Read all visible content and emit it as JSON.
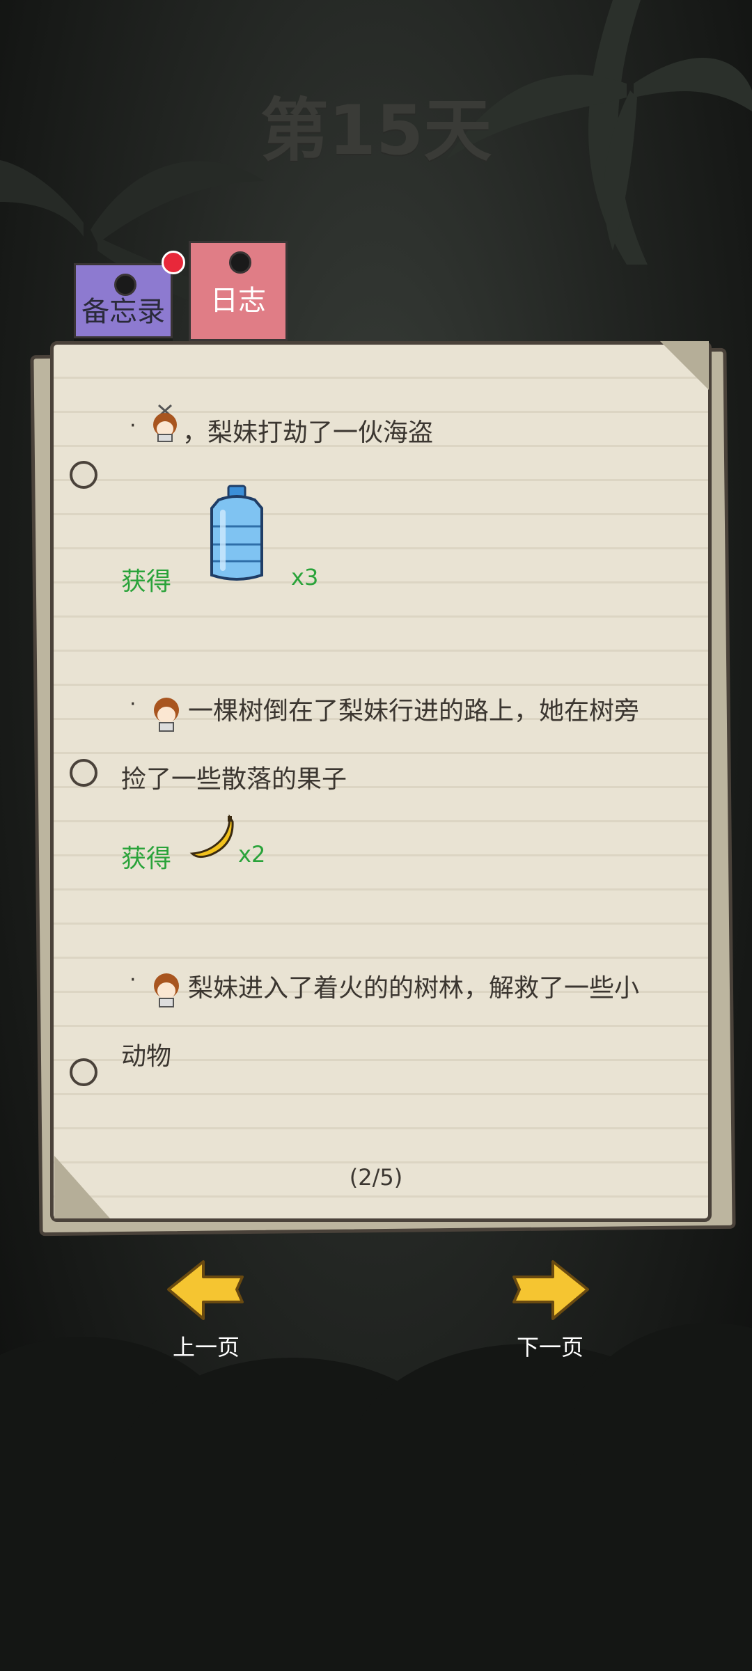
{
  "day_title": "第15天",
  "tabs": {
    "memo": "备忘录",
    "log": "日志"
  },
  "entries": [
    {
      "line1": "，梨妹打劫了一伙海盗",
      "reward_label": "获得",
      "reward_item": "water-jug-icon",
      "reward_qty": "x3"
    },
    {
      "line1": "一棵树倒在了梨妹行进的路上，她在树旁",
      "line2": "捡了一些散落的果子",
      "reward_label": "获得",
      "reward_item": "banana-icon",
      "reward_qty": "x2"
    },
    {
      "line1": "梨妹进入了着火的的树林，解救了一些小",
      "line2": "动物"
    }
  ],
  "bullet": "·",
  "page_indicator": "(2/5)",
  "nav": {
    "prev": "上一页",
    "next": "下一页"
  },
  "colors": {
    "memo_tab": "#8d7ad0",
    "log_tab": "#e07d86",
    "reward_green": "#2aa33a",
    "arrow_yellow": "#f5c531",
    "paper": "#e9e3d3"
  }
}
